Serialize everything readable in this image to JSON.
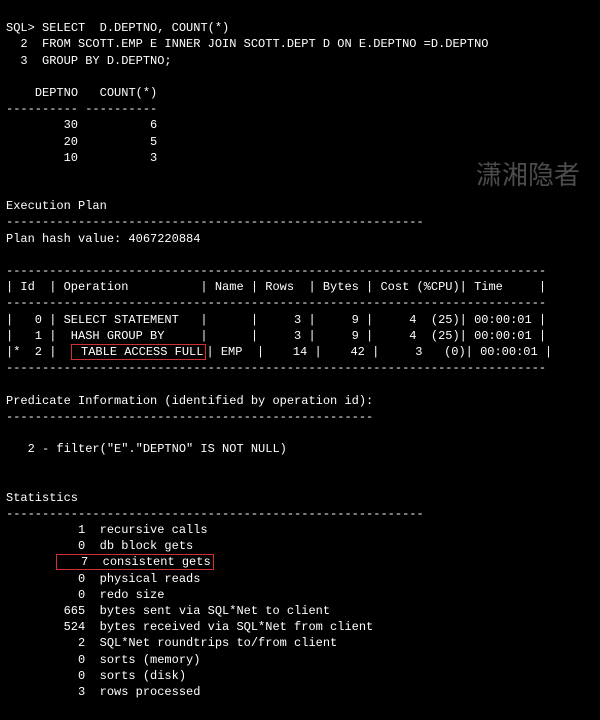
{
  "prompt": "SQL>",
  "sql": {
    "line1": "SELECT  D.DEPTNO, COUNT(*)",
    "line2_num": "2",
    "line2": "FROM SCOTT.EMP E INNER JOIN SCOTT.DEPT D ON E.DEPTNO =D.DEPTNO",
    "line3_num": "3",
    "line3": "GROUP BY D.DEPTNO;"
  },
  "result": {
    "headers": {
      "deptno": "DEPTNO",
      "count": "COUNT(*)"
    },
    "dash": "----------",
    "rows": [
      {
        "deptno": "30",
        "count": "6"
      },
      {
        "deptno": "20",
        "count": "5"
      },
      {
        "deptno": "10",
        "count": "3"
      }
    ]
  },
  "sections": {
    "exec_plan": "Execution Plan",
    "plan_hash": "Plan hash value: 4067220884",
    "pred_info": "Predicate Information (identified by operation id):",
    "stats": "Statistics"
  },
  "divider58": "----------------------------------------------------------",
  "plan": {
    "sep": "---------------------------------------------------------------------------",
    "hdr": "| Id  | Operation          | Name | Rows  | Bytes | Cost (%CPU)| Time     |",
    "row0": "|   0 | SELECT STATEMENT   |      |     3 |     9 |     4  (25)| 00:00:01 |",
    "row1": "|   1 |  HASH GROUP BY     |      |     3 |     9 |     4  (25)| 00:00:01 |",
    "row2_a": "|*  2 |  ",
    "row2_hl": " TABLE ACCESS FULL",
    "row2_b": "| EMP  |    14 |    42 |     3   (0)| 00:00:01 |"
  },
  "predicate": {
    "line": "   2 - filter(\"E\".\"DEPTNO\" IS NOT NULL)"
  },
  "stats": {
    "rows": [
      {
        "n": "1",
        "t": "recursive calls"
      },
      {
        "n": "0",
        "t": "db block gets"
      },
      {
        "n": "7",
        "t": "consistent gets",
        "hl": true
      },
      {
        "n": "0",
        "t": "physical reads"
      },
      {
        "n": "0",
        "t": "redo size"
      },
      {
        "n": "665",
        "t": "bytes sent via SQL*Net to client"
      },
      {
        "n": "524",
        "t": "bytes received via SQL*Net from client"
      },
      {
        "n": "2",
        "t": "SQL*Net roundtrips to/from client"
      },
      {
        "n": "0",
        "t": "sorts (memory)"
      },
      {
        "n": "0",
        "t": "sorts (disk)"
      },
      {
        "n": "3",
        "t": "rows processed"
      }
    ]
  },
  "watermark": "潇湘隐者"
}
